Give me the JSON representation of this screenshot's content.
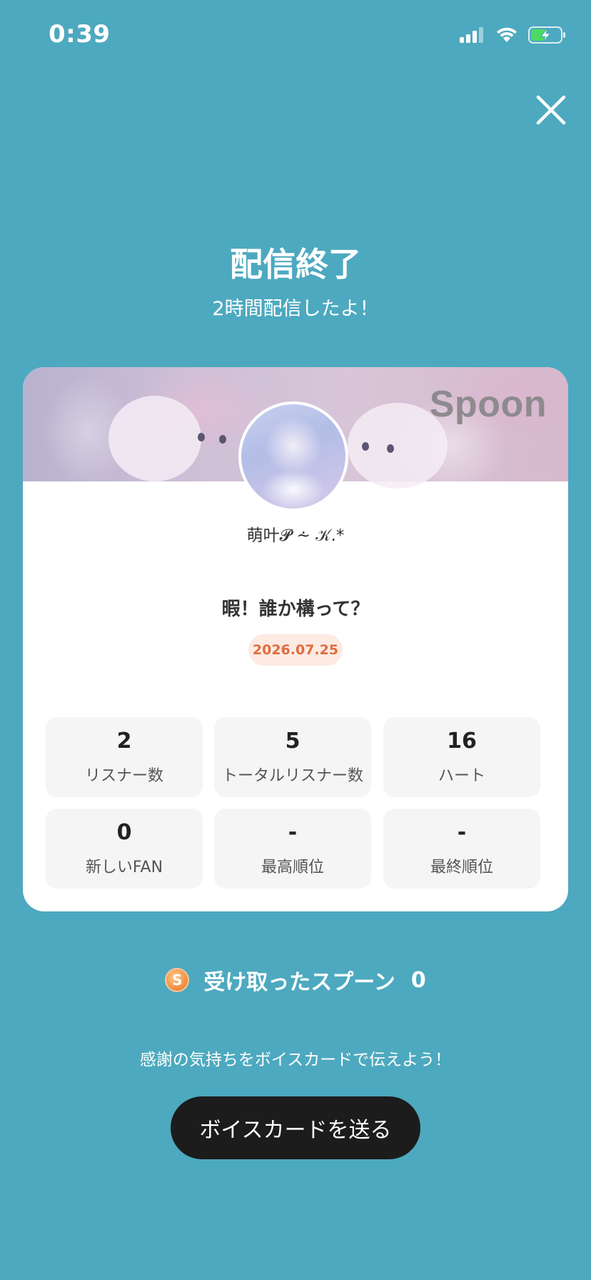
{
  "status_bar": {
    "time": "0:39"
  },
  "header": {
    "title": "配信終了",
    "subtitle": "2時間配信したよ！"
  },
  "card": {
    "watermark": "Spoon",
    "username": "萌叶𝓟 ⩪ 𝒦.*",
    "live_title": "暇！誰か構って？",
    "date": "2026.07.25",
    "stats": [
      {
        "value": "2",
        "label": "リスナー数"
      },
      {
        "value": "5",
        "label": "トータルリスナー数"
      },
      {
        "value": "16",
        "label": "ハート"
      },
      {
        "value": "0",
        "label": "新しいFAN"
      },
      {
        "value": "-",
        "label": "最高順位"
      },
      {
        "value": "-",
        "label": "最終順位"
      }
    ]
  },
  "spoons": {
    "coin_letter": "S",
    "label": "受け取ったスプーン",
    "count": "0"
  },
  "footer": {
    "thanks_text": "感謝の気持ちをボイスカードで伝えよう！",
    "voice_card_button": "ボイスカードを送る"
  },
  "colors": {
    "background": "#4da9bf",
    "button": "#1c1c1c",
    "date_text": "#e06d3e",
    "date_bg": "#fdeae3",
    "coin": "#f08b3a"
  },
  "icons": [
    "signal-icon",
    "wifi-icon",
    "battery-charging-icon",
    "close-icon",
    "spoon-coin-icon"
  ]
}
